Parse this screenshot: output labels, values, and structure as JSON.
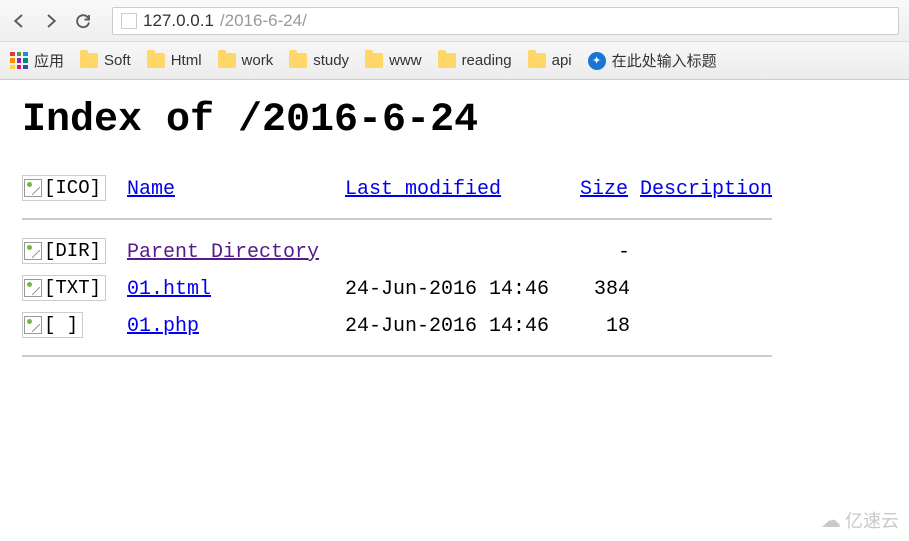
{
  "browser": {
    "url_host": "127.0.0.1",
    "url_path": "/2016-6-24/"
  },
  "bookmarks": {
    "apps_label": "应用",
    "items": [
      "Soft",
      "Html",
      "work",
      "study",
      "www",
      "reading",
      "api"
    ],
    "tool_placeholder": "在此处输入标题"
  },
  "page": {
    "title": "Index of /2016-6-24",
    "headers": {
      "icon_alt": "[ICO]",
      "name": "Name",
      "modified": "Last modified",
      "size": "Size",
      "description": "Description"
    },
    "rows": [
      {
        "icon_alt": "[DIR]",
        "name": "Parent Directory",
        "visited": true,
        "modified": "",
        "size": "-"
      },
      {
        "icon_alt": "[TXT]",
        "name": "01.html",
        "visited": false,
        "modified": "24-Jun-2016 14:46",
        "size": "384"
      },
      {
        "icon_alt": "[  ]",
        "name": "01.php",
        "visited": false,
        "modified": "24-Jun-2016 14:46",
        "size": "18"
      }
    ]
  },
  "watermark": {
    "text": "亿速云"
  }
}
